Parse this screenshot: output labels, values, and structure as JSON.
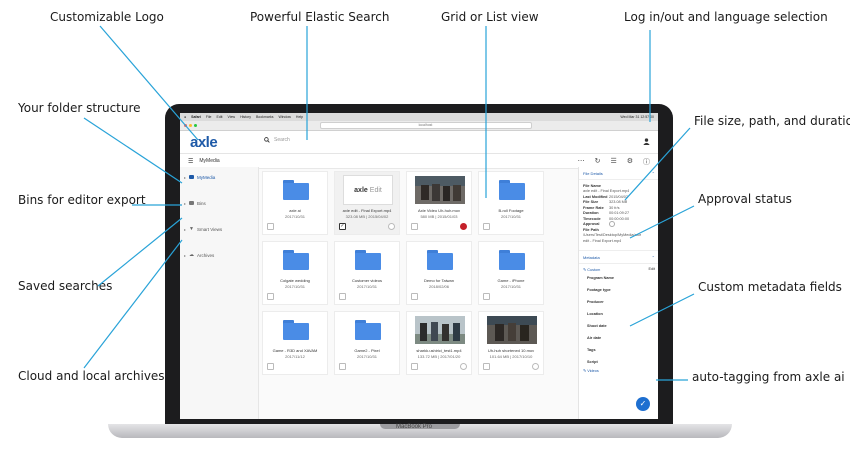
{
  "callouts": {
    "logo": "Customizable Logo",
    "search": "Powerful Elastic Search",
    "grid_list": "Grid or List view",
    "login_lang": "Log in/out and language selection",
    "folders": "Your folder structure",
    "file_info": "File size, path, and duration",
    "bins": "Bins for editor export",
    "approval": "Approval status",
    "saved_searches": "Saved searches",
    "custom_metadata": "Custom metadata fields",
    "archives": "Cloud and local archives",
    "auto_tagging": "auto-tagging from axle ai"
  },
  "mac_menu": {
    "app": "Safari",
    "items": [
      "File",
      "Edit",
      "View",
      "History",
      "Bookmarks",
      "Window",
      "Help"
    ],
    "clock": "Wed Mar 31  12:57:00"
  },
  "browser": {
    "url": "localhost"
  },
  "app": {
    "logo": "axle",
    "search_placeholder": "Search",
    "breadcrumb": "MyMedia"
  },
  "sidebar": {
    "items": [
      {
        "label": "MyMedia",
        "icon": "folder-icon"
      },
      {
        "label": "Bins",
        "icon": "bin-icon"
      },
      {
        "label": "Smart Views",
        "icon": "filter-icon"
      },
      {
        "label": "Archives",
        "icon": "cloud-icon"
      }
    ]
  },
  "grid": {
    "tiles": [
      {
        "type": "folder",
        "name": "axle ai",
        "meta": "2017/10/31"
      },
      {
        "type": "axle",
        "thumb_text": "axle",
        "thumb_sub": "Edit",
        "name": "axle edit - Final Export.mp4",
        "meta": "323.08 MB | 2015/04/02"
      },
      {
        "type": "video",
        "name": "Axle Video Uh-huh.mov",
        "meta": "580 MB | 2015/01/03"
      },
      {
        "type": "folder",
        "name": "B-roll Footage",
        "meta": "2017/10/31"
      },
      {
        "type": "folder",
        "name": "Colgate wedding",
        "meta": "2017/10/31"
      },
      {
        "type": "folder",
        "name": "Customer videos",
        "meta": "2017/10/31"
      },
      {
        "type": "folder",
        "name": "Demo for Taiwan",
        "meta": "2018/02/06"
      },
      {
        "type": "folder",
        "name": "Game - iPhone",
        "meta": "2017/10/31"
      },
      {
        "type": "folder",
        "name": "Game - R3D and XAVAM",
        "meta": "2017/11/12"
      },
      {
        "type": "folder",
        "name": "Game2 - Pixel",
        "meta": "2017/10/31"
      },
      {
        "type": "video",
        "name": "sharkk.ushirici_test1.mp4",
        "meta": "133.72 MB | 2017/01/20"
      },
      {
        "type": "video",
        "name": "Uh-huh shortened 10.mov",
        "meta": "101.64 MB | 2017/10/10"
      }
    ]
  },
  "panel": {
    "file_details_title": "File Details",
    "rows": [
      {
        "k": "File Name",
        "v": ""
      },
      {
        "k": "",
        "v": "axle edit - Final Export.mp4"
      },
      {
        "k": "Last Modified",
        "v": "2015/04/02"
      },
      {
        "k": "File Size",
        "v": "323.08 MB"
      },
      {
        "k": "Frame Rate",
        "v": "30 fr/s"
      },
      {
        "k": "Duration",
        "v": "00:01:09:27"
      },
      {
        "k": "Timecode",
        "v": "00:00:00:00"
      },
      {
        "k": "Approval",
        "v": ""
      },
      {
        "k": "File Path",
        "v": ""
      },
      {
        "k": "",
        "v": "/Users/Test/Desktop/MyMedia/axle"
      },
      {
        "k": "",
        "v": "edit - Final Export.mp4"
      }
    ],
    "metadata_title": "Metadata",
    "custom_label": "Custom",
    "edit_label": "Edit",
    "fields": [
      "Program Name",
      "Footage type",
      "Producer",
      "Location",
      "Shoot date",
      "Air date",
      "Tags",
      "Script"
    ],
    "videos_link": "Videos"
  },
  "laptop_label": "MacBook Pro"
}
